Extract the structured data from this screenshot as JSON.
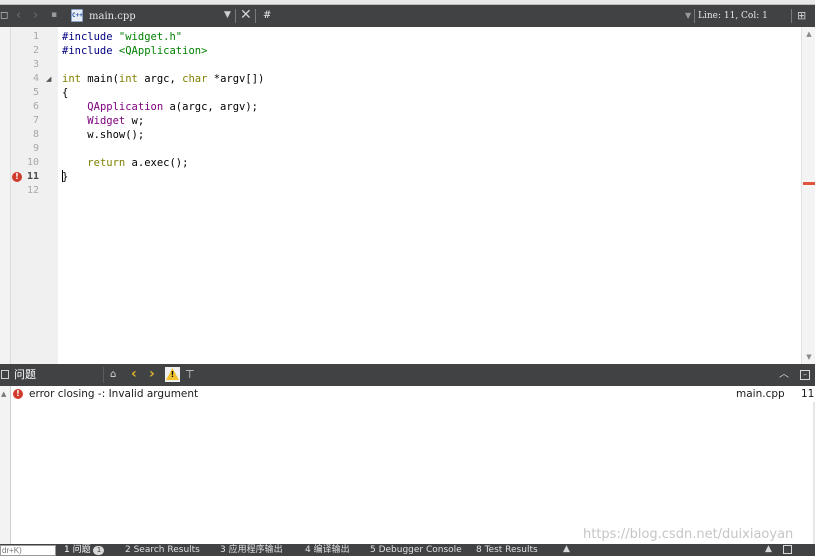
{
  "toolbar": {
    "back_icon": "‹",
    "forward_icon": "›",
    "lock_icon": "🔒",
    "file_icon_label": "C++",
    "file_name": "main.cpp",
    "dropdown_icon": "▼",
    "close_icon": "✕",
    "symbol": "#",
    "line_col": "Line: 11, Col: 1",
    "split_icon": "⊞"
  },
  "editor": {
    "lines": [
      {
        "num": "1",
        "text": "#include \"widget.h\""
      },
      {
        "num": "2",
        "text": "#include <QApplication>"
      },
      {
        "num": "3",
        "text": ""
      },
      {
        "num": "4",
        "text": "int main(int argc, char *argv[])"
      },
      {
        "num": "5",
        "text": "{"
      },
      {
        "num": "6",
        "text": "    QApplication a(argc, argv);"
      },
      {
        "num": "7",
        "text": "    Widget w;"
      },
      {
        "num": "8",
        "text": "    w.show();"
      },
      {
        "num": "9",
        "text": ""
      },
      {
        "num": "10",
        "text": "    return a.exec();"
      },
      {
        "num": "11",
        "text": "}"
      },
      {
        "num": "12",
        "text": ""
      }
    ],
    "error_line": "11",
    "fold_icon": "◢"
  },
  "issues": {
    "title": "问题",
    "filter_icon": "⊤",
    "items": [
      {
        "message": "error closing -: Invalid argument",
        "file": "main.cpp",
        "line": "11"
      }
    ]
  },
  "watermark": "https://blog.csdn.net/duixiaoyan",
  "bottom_bar": {
    "locator_placeholder": "dr+K)",
    "tabs": [
      {
        "label": "1 问题",
        "badge": "1"
      },
      {
        "label": "2 Search Results"
      },
      {
        "label": "3 应用程序输出"
      },
      {
        "label": "4 编译输出"
      },
      {
        "label": "5 Debugger Console"
      },
      {
        "label": "8 Test Results"
      }
    ]
  },
  "colors": {
    "toolbar_bg": "#404244",
    "error": "#d03b2b",
    "warning": "#f2c12e",
    "keyword": "#808000",
    "preprocessor": "#000080",
    "string": "#008000",
    "type": "#800080"
  }
}
